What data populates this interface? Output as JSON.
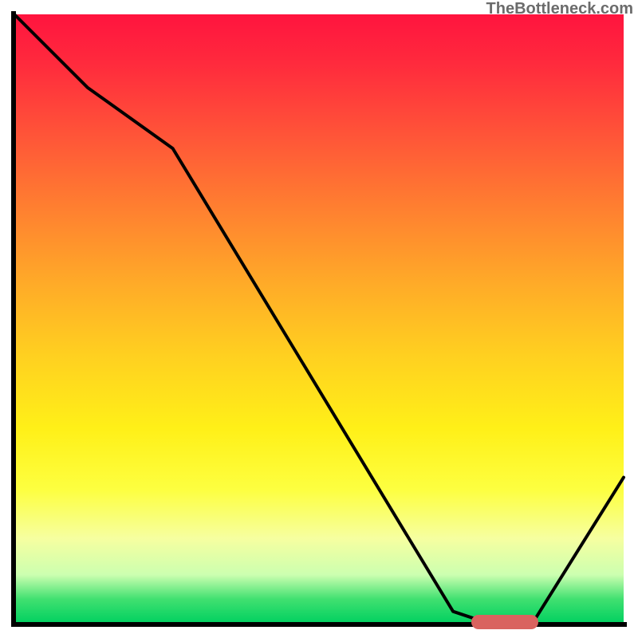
{
  "watermark": "TheBottleneck.com",
  "chart_data": {
    "type": "line",
    "title": "",
    "xlabel": "",
    "ylabel": "",
    "xlim": [
      0,
      100
    ],
    "ylim": [
      0,
      100
    ],
    "x": [
      0,
      12,
      26,
      72,
      78,
      85,
      100
    ],
    "values": [
      100,
      88,
      78,
      2,
      0,
      0,
      24
    ],
    "marker": {
      "x_start": 75,
      "x_end": 86,
      "y": 0
    },
    "background_gradient": {
      "top_color": "#ff143e",
      "mid_color": "#ffd020",
      "bottom_color": "#00d060"
    }
  }
}
